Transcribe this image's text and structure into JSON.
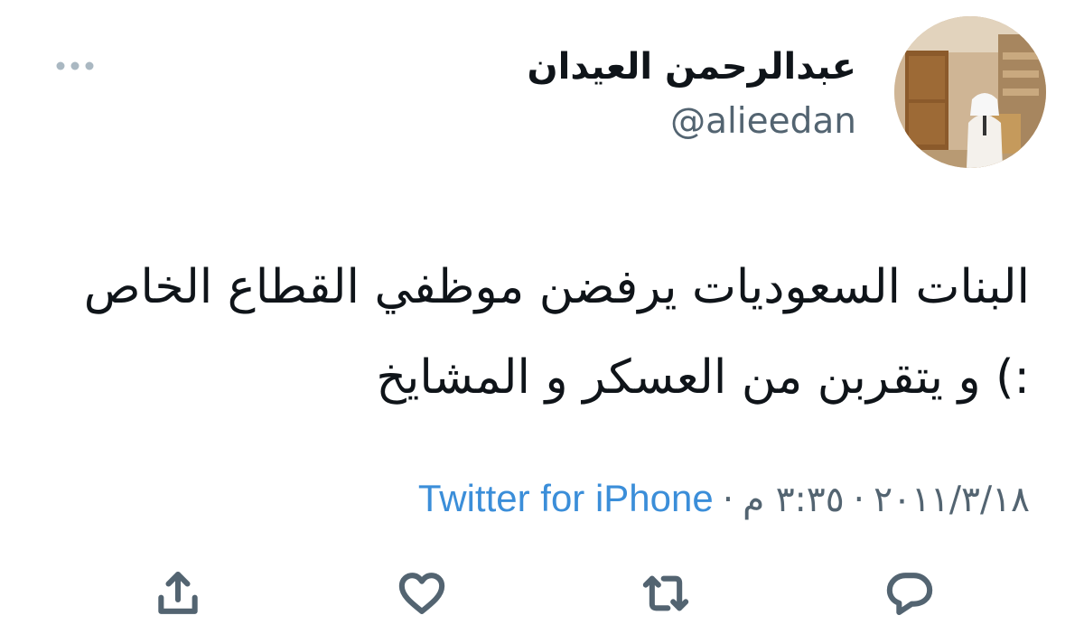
{
  "tweet": {
    "author": {
      "display_name": "عبدالرحمن العيدان",
      "handle": "@alieedan"
    },
    "text": "البنات السعوديات يرفضن موظفي القطاع الخاص :) و يتقربن من العسكر و المشايخ",
    "date": "٢٠١١/٣/١٨",
    "time": "٣:٣٥ م",
    "separator": "·",
    "source": "Twitter for iPhone"
  },
  "colors": {
    "text_primary": "#0f1419",
    "text_secondary": "#536471",
    "source_link": "#3b8ed9",
    "icons": "#536471"
  },
  "icons": {
    "more": "more-dots-icon",
    "share": "share-icon",
    "like": "heart-icon",
    "retweet": "retweet-icon",
    "reply": "reply-icon"
  }
}
